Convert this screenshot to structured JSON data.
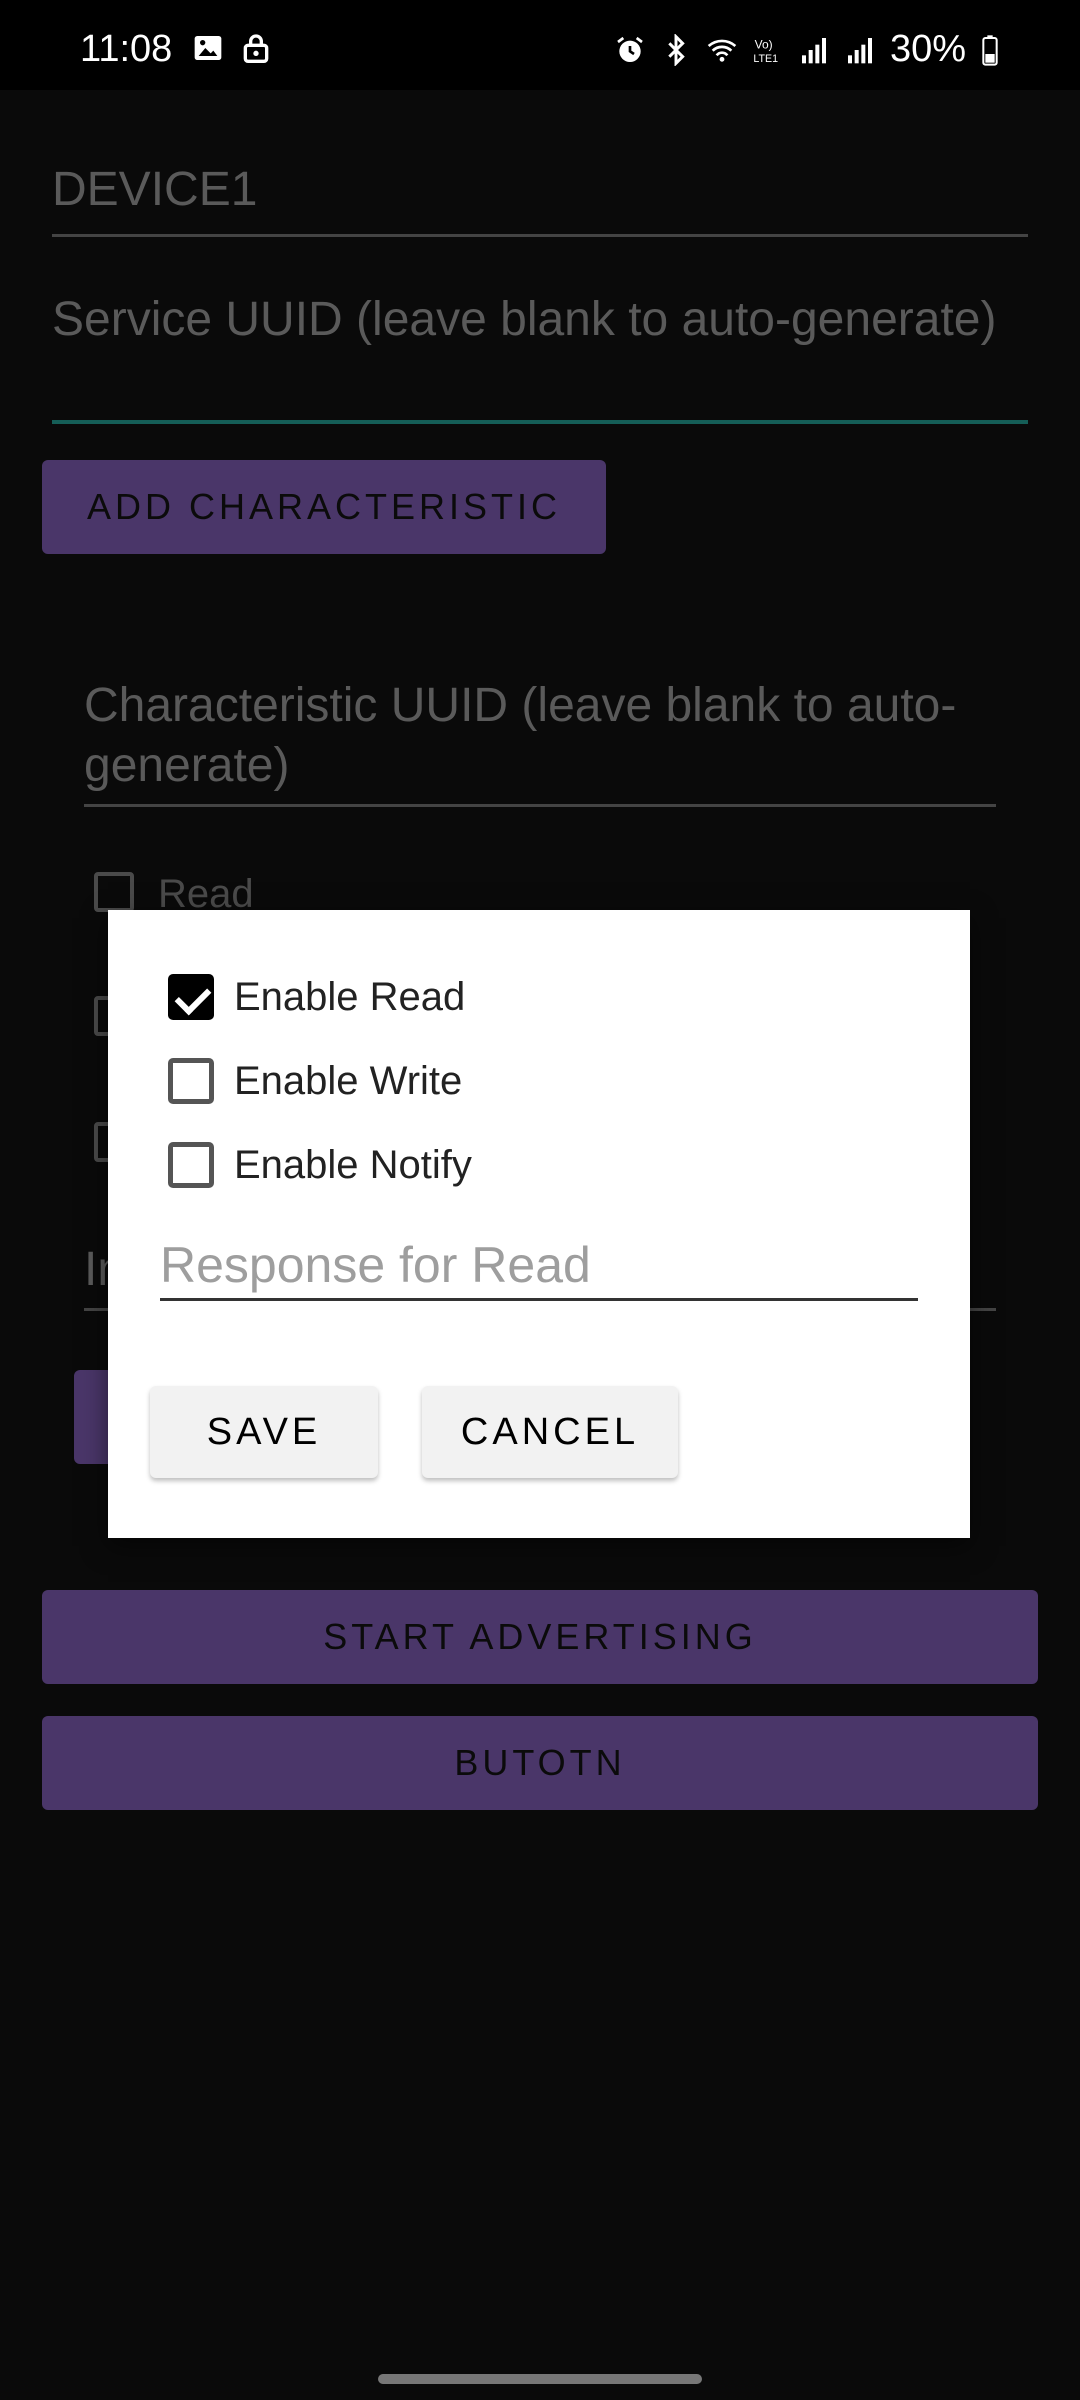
{
  "status_bar": {
    "time": "11:08",
    "battery": "30%",
    "left_icons": [
      "image-icon",
      "lock-icon"
    ],
    "right_icons": [
      "alarm-icon",
      "bluetooth-icon",
      "wifi-icon",
      "volte-icon",
      "signal-icon",
      "signal-icon",
      "battery-icon"
    ]
  },
  "form": {
    "device_name": "DEVICE1",
    "service_uuid_placeholder": "Service UUID (leave blank to auto-generate)",
    "add_characteristic_label": "ADD CHARACTERISTIC",
    "characteristic_uuid_placeholder": "Characteristic UUID (leave blank to auto-generate)",
    "read_checkbox_label": "Read",
    "partial_field_text": "In",
    "start_advertising_label": "START ADVERTISING",
    "extra_button_label": "BUTOTN"
  },
  "dialog": {
    "options": [
      {
        "label": "Enable Read",
        "checked": true
      },
      {
        "label": "Enable Write",
        "checked": false
      },
      {
        "label": "Enable Notify",
        "checked": false
      }
    ],
    "response_placeholder": "Response for Read",
    "save_label": "SAVE",
    "cancel_label": "CANCEL"
  },
  "colors": {
    "accent": "#7e57c2",
    "focus_underline": "#1fa79a",
    "dialog_background": "#ffffff"
  }
}
